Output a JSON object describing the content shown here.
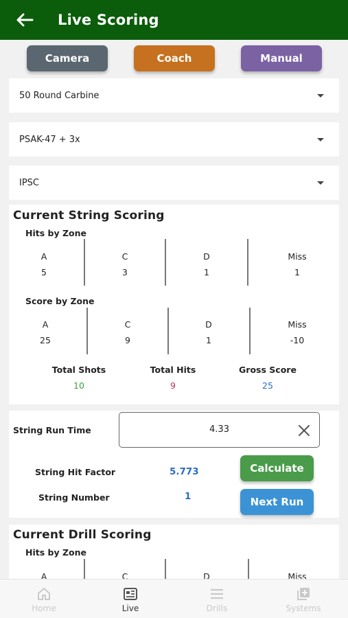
{
  "header": {
    "title": "Live Scoring",
    "back_icon": "arrow-left-icon"
  },
  "modes": [
    {
      "label": "Camera",
      "color": "#5b6770"
    },
    {
      "label": "Coach",
      "color": "#c6711f"
    },
    {
      "label": "Manual",
      "color": "#7b62a3"
    }
  ],
  "selects": {
    "course": "50 Round Carbine",
    "firearm": "PSAK-47 + 3x",
    "scoring_system": "IPSC"
  },
  "string_scoring": {
    "title": "Current String Scoring",
    "hits_title": "Hits by Zone",
    "score_title": "Score by Zone",
    "hits": [
      {
        "zone": "A",
        "value": "5"
      },
      {
        "zone": "C",
        "value": "3"
      },
      {
        "zone": "D",
        "value": "1"
      },
      {
        "zone": "Miss",
        "value": "1"
      }
    ],
    "scores": [
      {
        "zone": "A",
        "value": "25"
      },
      {
        "zone": "C",
        "value": "9"
      },
      {
        "zone": "D",
        "value": "1"
      },
      {
        "zone": "Miss",
        "value": "-10"
      }
    ],
    "totals": {
      "shots_label": "Total Shots",
      "shots": "10",
      "shots_color": "#3aa23a",
      "hits_label": "Total Hits",
      "hits": "9",
      "hits_color": "#b0325a",
      "score_label": "Gross Score",
      "score": "25",
      "score_color": "#2a6dc4"
    }
  },
  "run": {
    "time_label": "String Run Time",
    "time_value": "4.33",
    "hit_factor_label": "String Hit Factor",
    "hit_factor": "5.773",
    "string_number_label": "String Number",
    "string_number": "1",
    "calculate_label": "Calculate",
    "calculate_color": "#4a9b4a",
    "next_run_label": "Next Run",
    "next_run_color": "#3b93d6"
  },
  "drill_scoring": {
    "title": "Current Drill Scoring",
    "hits_title": "Hits by Zone",
    "zones": [
      "A",
      "C",
      "D",
      "Miss"
    ]
  },
  "nav": [
    {
      "label": "Home",
      "icon": "home-icon",
      "active": false
    },
    {
      "label": "Live",
      "icon": "scoreboard-icon",
      "active": true
    },
    {
      "label": "Drills",
      "icon": "list-icon",
      "active": false
    },
    {
      "label": "Systems",
      "icon": "add-box-icon",
      "active": false
    }
  ]
}
